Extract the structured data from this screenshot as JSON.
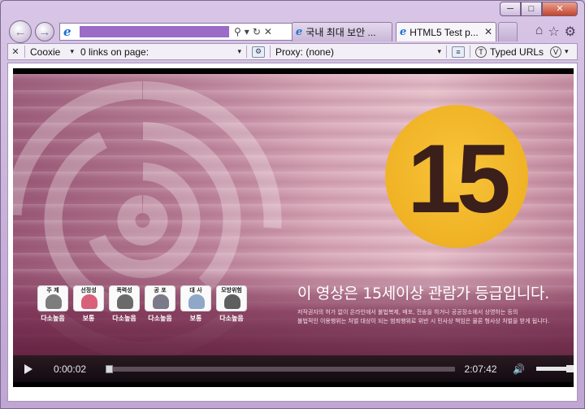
{
  "window": {
    "controls": {
      "minimize": "─",
      "maximize": "□",
      "close": "✕"
    }
  },
  "nav": {
    "back_icon": "back-arrow-icon",
    "forward_icon": "forward-arrow-icon",
    "address_favicon": "e",
    "address_tools": {
      "search": "⚲",
      "dropdown": "▾",
      "refresh": "↻",
      "stop": "✕"
    }
  },
  "tabs": [
    {
      "label": "국내 최대 보안 ...",
      "active": false,
      "favicon": "e"
    },
    {
      "label": "HTML5 Test p...",
      "active": true,
      "favicon": "e",
      "close": "✕"
    }
  ],
  "toolbar_right": {
    "home": "⌂",
    "favorites": "☆",
    "settings": "⚙"
  },
  "toolbar": {
    "close": "✕",
    "cookie_label": "Cooxie",
    "links_label": "0 links on page:",
    "proxy_label": "Proxy: (none)",
    "typed_urls_label": "Typed URLs",
    "caret": "▾"
  },
  "video": {
    "rating_number": "15",
    "rating_notice": "이 영상은 15세이상 관람가 등급입니다.",
    "fineprint_line1": "저작권자의 허가 없이 온라인에서 불법복제, 배포, 전송을 하거나 공공장소에서 상영하는 등의",
    "fineprint_line2": "불법적인 이용행위는 처벌 대상이 되는 범죄행위로 위반 시 민사상 책임은 물론 형사상 처벌을 받게 됩니다.",
    "content_icons": [
      {
        "title": "주 제",
        "label": "다소높음",
        "color": "#7d7d7d"
      },
      {
        "title": "선정성",
        "label": "보통",
        "color": "#d9607a"
      },
      {
        "title": "폭력성",
        "label": "다소높음",
        "color": "#6a6a6a"
      },
      {
        "title": "공 포",
        "label": "다소높음",
        "color": "#7a7a8a"
      },
      {
        "title": "대 사",
        "label": "보통",
        "color": "#8fa8c8"
      },
      {
        "title": "모방위험",
        "label": "다소높음",
        "color": "#5e5e5e"
      }
    ]
  },
  "player": {
    "time_current": "0:00:02",
    "time_total": "2:07:42",
    "progress": 0.0003,
    "volume": 0.8,
    "play_icon": "play-icon",
    "volume_icon": "🔊"
  },
  "colors": {
    "accent_purple": "#9b6bc7",
    "rating_yellow": "#f0b225",
    "rating_text": "#3b1f1a"
  }
}
